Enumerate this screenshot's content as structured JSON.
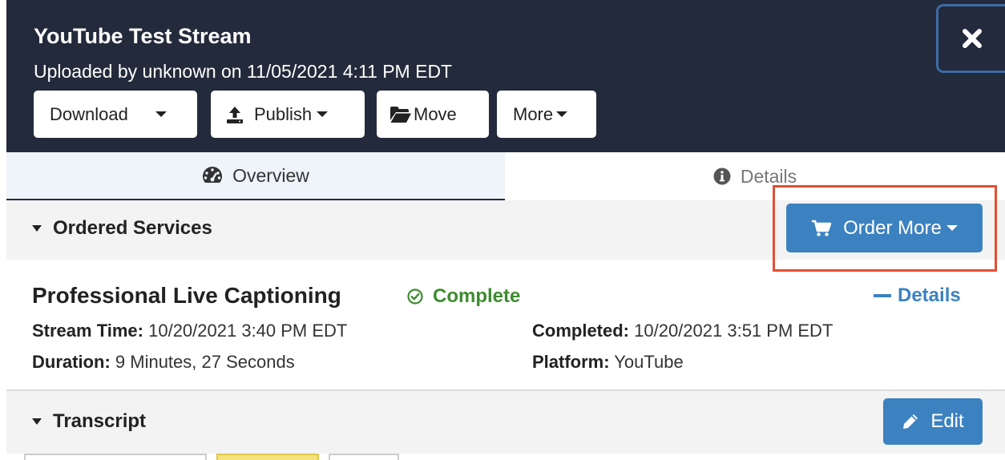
{
  "header": {
    "title": "YouTube Test Stream",
    "subtitle": "Uploaded by unknown on 11/05/2021 4:11 PM EDT"
  },
  "toolbar": {
    "download_label": "Download",
    "publish_label": "Publish",
    "move_label": "Move",
    "more_label": "More"
  },
  "tabs": [
    {
      "label": "Overview",
      "active": true
    },
    {
      "label": "Details",
      "active": false
    }
  ],
  "ordered_services": {
    "title": "Ordered Services",
    "order_more_label": "Order More"
  },
  "service": {
    "name": "Professional Live Captioning",
    "status": "Complete",
    "details_link": "Details",
    "stream_time_label": "Stream Time:",
    "stream_time": "10/20/2021 3:40 PM EDT",
    "duration_label": "Duration:",
    "duration": "9 Minutes, 27 Seconds",
    "completed_label": "Completed:",
    "completed": "10/20/2021 3:51 PM EDT",
    "platform_label": "Platform:",
    "platform": "YouTube"
  },
  "transcript": {
    "title": "Transcript",
    "edit_label": "Edit"
  },
  "colors": {
    "header_bg": "#232a3b",
    "primary": "#3c82c0",
    "success": "#3c8c2e",
    "highlight": "#e34f32"
  }
}
